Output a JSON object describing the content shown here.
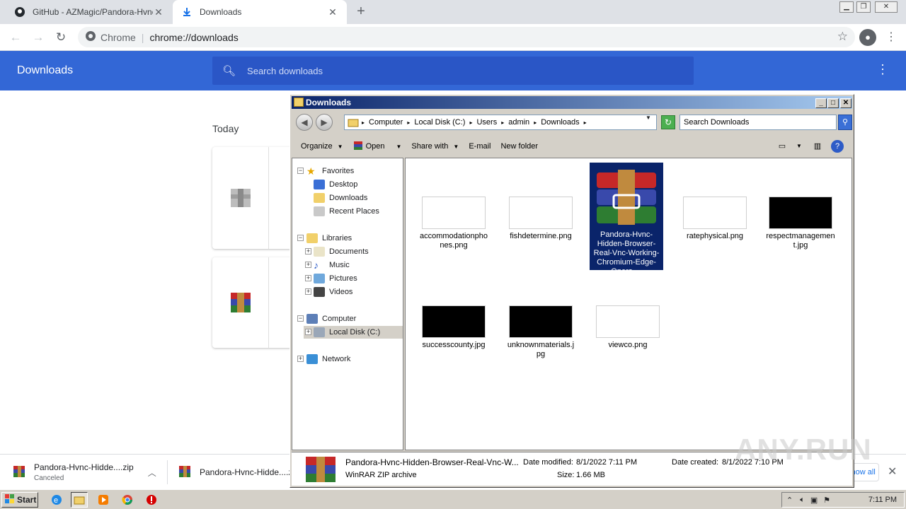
{
  "browser": {
    "tabs": [
      {
        "title": "GitHub - AZMagic/Pandora-Hvnc-Hid",
        "icon": "github-icon"
      },
      {
        "title": "Downloads",
        "icon": "download-icon"
      }
    ],
    "omnibox": {
      "label": "Chrome",
      "url": "chrome://downloads"
    }
  },
  "downloads_page": {
    "title": "Downloads",
    "search_placeholder": "Search downloads",
    "date_heading": "Today"
  },
  "shelf": {
    "items": [
      {
        "name": "Pandora-Hvnc-Hidde....zip",
        "status": "Canceled"
      },
      {
        "name": "Pandora-Hvnc-Hidde....zip",
        "status": ""
      }
    ],
    "show_all": "Show all"
  },
  "explorer": {
    "title": "Downloads",
    "breadcrumb": [
      "Computer",
      "Local Disk (C:)",
      "Users",
      "admin",
      "Downloads"
    ],
    "search_placeholder": "Search Downloads",
    "commands": [
      "Organize",
      "Open",
      "Share with",
      "E-mail",
      "New folder"
    ],
    "nav": {
      "favorites": "Favorites",
      "desktop": "Desktop",
      "downloads": "Downloads",
      "recent": "Recent Places",
      "libraries": "Libraries",
      "documents": "Documents",
      "music": "Music",
      "pictures": "Pictures",
      "videos": "Videos",
      "computer": "Computer",
      "local_disk": "Local Disk (C:)",
      "network": "Network"
    },
    "files": [
      {
        "name": "accommodationphones.png",
        "thumb": "white"
      },
      {
        "name": "fishdetermine.png",
        "thumb": "white"
      },
      {
        "name": "Pandora-Hvnc-Hidden-Browser-Real-Vnc-Working-Chromium-Edge-Opera-...",
        "thumb": "winrar",
        "selected": true
      },
      {
        "name": "ratephysical.png",
        "thumb": "white"
      },
      {
        "name": "respectmanagement.jpg",
        "thumb": "black"
      },
      {
        "name": "successcounty.jpg",
        "thumb": "black"
      },
      {
        "name": "unknownmaterials.jpg",
        "thumb": "black"
      },
      {
        "name": "viewco.png",
        "thumb": "white"
      }
    ],
    "details": {
      "name": "Pandora-Hvnc-Hidden-Browser-Real-Vnc-W...",
      "type": "WinRAR ZIP archive",
      "modified_label": "Date modified:",
      "modified": "8/1/2022 7:11 PM",
      "size_label": "Size:",
      "size": "1.66 MB",
      "created_label": "Date created:",
      "created": "8/1/2022 7:10 PM"
    }
  },
  "taskbar": {
    "start": "Start",
    "clock": "7:11 PM"
  },
  "watermark": "ANY.RUN",
  "colors": {
    "chrome_blue": "#3367d6",
    "selection": "#0a246a"
  }
}
